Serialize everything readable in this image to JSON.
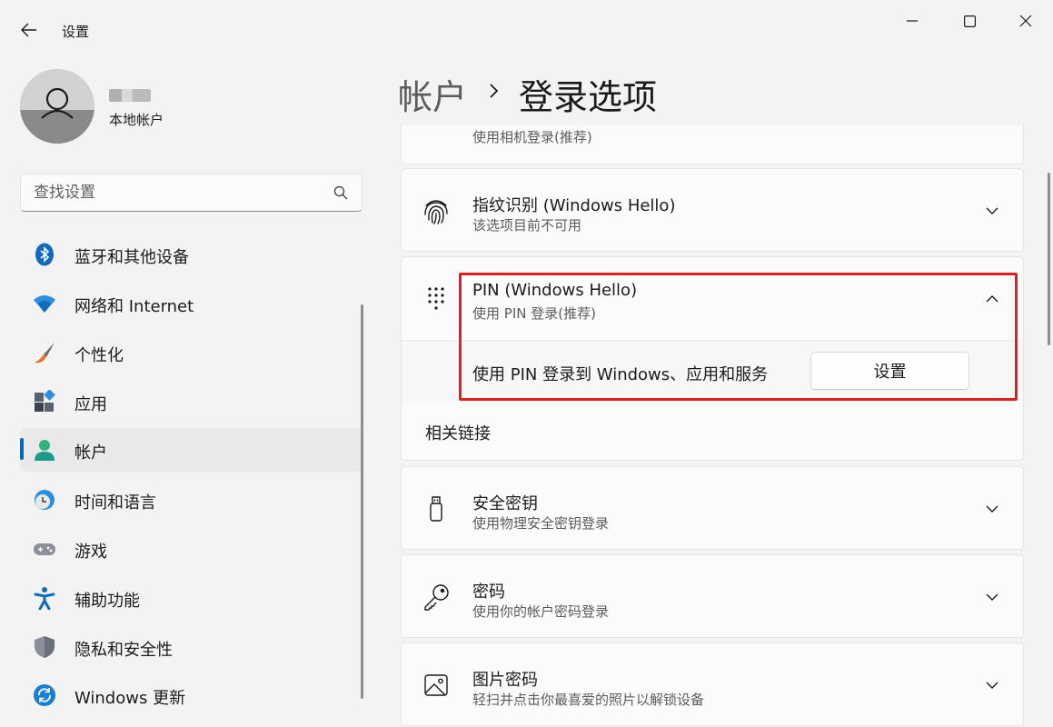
{
  "window": {
    "title": "设置",
    "controls": {
      "minimize": "minimize-icon",
      "maximize": "maximize-icon",
      "close": "close-icon"
    }
  },
  "profile": {
    "account_type": "本地帐户"
  },
  "search": {
    "placeholder": "查找设置"
  },
  "sidebar": {
    "items": [
      {
        "label": "蓝牙和其他设备",
        "icon": "bluetooth-icon"
      },
      {
        "label": "网络和 Internet",
        "icon": "wifi-icon"
      },
      {
        "label": "个性化",
        "icon": "brush-icon"
      },
      {
        "label": "应用",
        "icon": "apps-icon"
      },
      {
        "label": "帐户",
        "icon": "account-icon",
        "active": true
      },
      {
        "label": "时间和语言",
        "icon": "clock-globe-icon"
      },
      {
        "label": "游戏",
        "icon": "gamepad-icon"
      },
      {
        "label": "辅助功能",
        "icon": "accessibility-icon"
      },
      {
        "label": "隐私和安全性",
        "icon": "shield-icon"
      },
      {
        "label": "Windows 更新",
        "icon": "update-icon"
      }
    ]
  },
  "header": {
    "parent": "帐户",
    "current": "登录选项"
  },
  "options": {
    "camera_sub": "使用相机登录(推荐)",
    "fingerprint": {
      "title": "指纹识别 (Windows Hello)",
      "subtitle": "该选项目前不可用"
    },
    "pin": {
      "title": "PIN (Windows Hello)",
      "subtitle": "使用 PIN 登录(推荐)",
      "description": "使用 PIN 登录到 Windows、应用和服务",
      "button": "设置"
    },
    "related_links": "相关链接",
    "security_key": {
      "title": "安全密钥",
      "subtitle": "使用物理安全密钥登录"
    },
    "password": {
      "title": "密码",
      "subtitle": "使用你的帐户密码登录"
    },
    "picture_password": {
      "title": "图片密码",
      "subtitle": "轻扫并点击你最喜爱的照片以解锁设备"
    }
  },
  "colors": {
    "accent": "#0067c0",
    "highlight": "#e0201c"
  }
}
